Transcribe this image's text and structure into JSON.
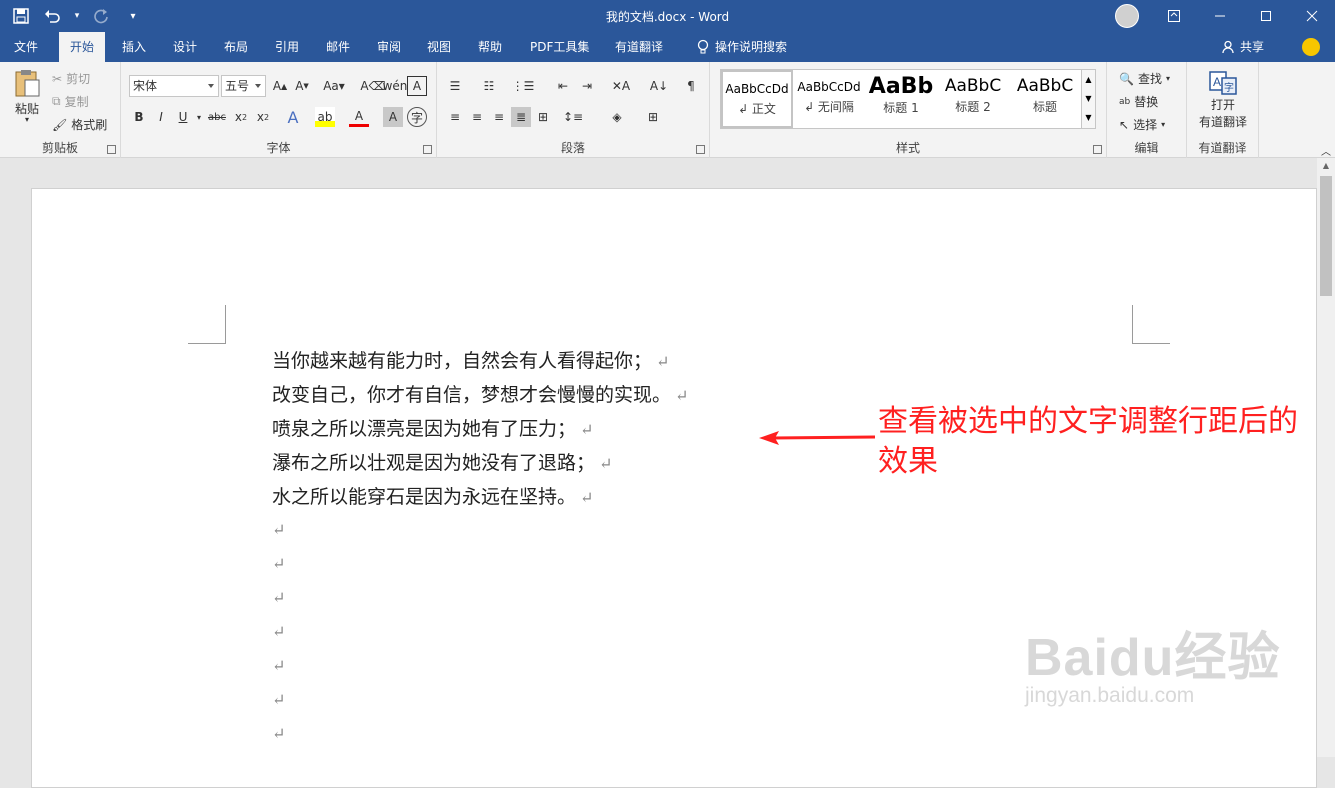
{
  "window": {
    "title": "我的文档.docx  -  Word"
  },
  "tabs": [
    "文件",
    "开始",
    "插入",
    "设计",
    "布局",
    "引用",
    "邮件",
    "审阅",
    "视图",
    "帮助",
    "PDF工具集",
    "有道翻译"
  ],
  "active_tab": "开始",
  "tell_me": "操作说明搜索",
  "share_label": "共享",
  "clipboard": {
    "paste": "粘贴",
    "cut": "剪切",
    "copy": "复制",
    "format_painter": "格式刷",
    "label": "剪贴板"
  },
  "font": {
    "name": "宋体",
    "size": "五号",
    "label": "字体"
  },
  "paragraph": {
    "label": "段落"
  },
  "styles": {
    "label": "样式",
    "items": [
      {
        "sample": "AaBbCcDd",
        "name": "↲ 正文"
      },
      {
        "sample": "AaBbCcDd",
        "name": "↲ 无间隔"
      },
      {
        "sample": "AaBb",
        "name": "标题 1"
      },
      {
        "sample": "AaBbC",
        "name": "标题 2"
      },
      {
        "sample": "AaBbC",
        "name": "标题"
      }
    ]
  },
  "editing": {
    "find": "查找",
    "replace": "替换",
    "select": "选择",
    "label": "编辑"
  },
  "youdao": {
    "open_line1": "打开",
    "open_line2": "有道翻译",
    "label": "有道翻译"
  },
  "document": {
    "lines": [
      "当你越来越有能力时，自然会有人看得起你；",
      "改变自己，你才有自信，梦想才会慢慢的实现。",
      "喷泉之所以漂亮是因为她有了压力；",
      "瀑布之所以壮观是因为她没有了退路；",
      "水之所以能穿石是因为永远在坚持。"
    ],
    "para_mark": "↵"
  },
  "annotation": {
    "text": "查看被选中的文字调整行距后的效果",
    "color": "#ff2020"
  },
  "watermark": {
    "main": "Baidu经验",
    "sub": "jingyan.baidu.com"
  },
  "colors": {
    "brand": "#2b579a"
  }
}
